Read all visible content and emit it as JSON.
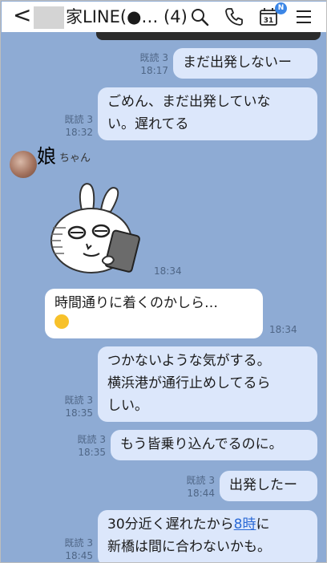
{
  "header": {
    "back": "<",
    "title": "家LINE(●… (4)",
    "calendar_day": "31",
    "calendar_badge": "N"
  },
  "messages": [
    {
      "from": "me",
      "text": "まだ出発しないー",
      "read": "既読 3",
      "time": "18:17"
    },
    {
      "from": "me",
      "lines": [
        "ごめん、まだ出発していな",
        "い。遅れてる"
      ],
      "read": "既読 3",
      "time": "18:32"
    },
    {
      "from": "other",
      "type": "sticker",
      "time": "18:34"
    },
    {
      "from": "other",
      "text": "時間通りに着くのかしら…",
      "time": "18:34"
    },
    {
      "from": "me",
      "lines": [
        "つかないような気がする。",
        "横浜港が通行止めしてるら",
        "しい。"
      ],
      "read": "既読 3",
      "time": "18:35"
    },
    {
      "from": "me",
      "text": "もう皆乗り込んでるのに。",
      "read": "既読 3",
      "time": "18:35"
    },
    {
      "from": "me",
      "text": "出発したー",
      "read": "既読 3",
      "time": "18:44"
    },
    {
      "from": "me",
      "line1_a": "30分近く遅れたから",
      "line1_link": "8時",
      "line1_b": "に",
      "line2": "新橋は間に合わないかも。",
      "read": "既読 3",
      "time": "18:45"
    }
  ],
  "sender": {
    "name_big": "娘",
    "name_small": "ちゃん"
  }
}
